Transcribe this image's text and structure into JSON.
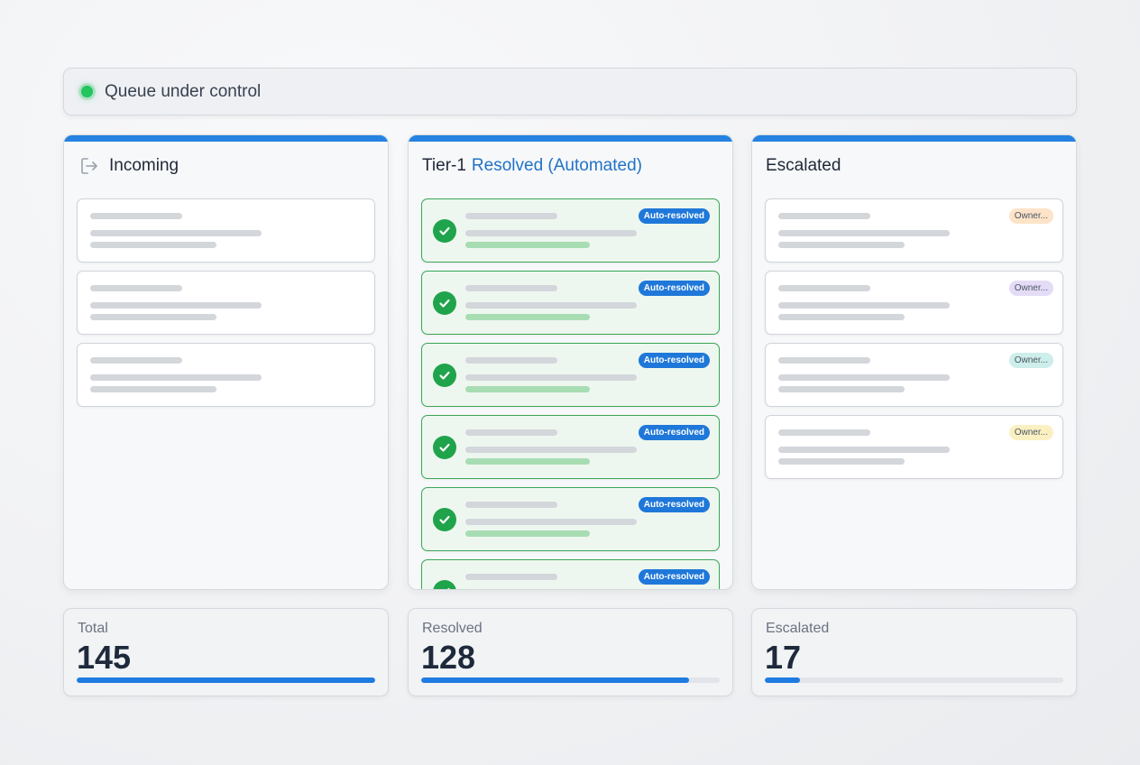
{
  "status": {
    "text": "Queue under control",
    "color": "#22c55e"
  },
  "columns": {
    "incoming": {
      "title": "Incoming",
      "icon": "sign-out-arrow-icon",
      "card_count": 3
    },
    "resolved": {
      "title_prefix": "Tier-1",
      "title_accent": "Resolved (Automated)",
      "badge_label": "Auto-resolved",
      "card_count": 6
    },
    "escalated": {
      "title": "Escalated",
      "cards": [
        {
          "badge": "Owner...",
          "badge_color": "#fde3c8"
        },
        {
          "badge": "Owner...",
          "badge_color": "#e4dcf7"
        },
        {
          "badge": "Owner...",
          "badge_color": "#cdeeea"
        },
        {
          "badge": "Owner...",
          "badge_color": "#fbf0c2"
        }
      ]
    }
  },
  "stats": {
    "total": {
      "label": "Total",
      "value": "145",
      "fill": 1.0
    },
    "resolved": {
      "label": "Resolved",
      "value": "128",
      "fill": 0.898
    },
    "escalated": {
      "label": "Escalated",
      "value": "17",
      "fill": 0.119
    }
  },
  "colors": {
    "accent": "#2582e0",
    "success": "#1fa44c",
    "badge_blue": "#1f78d9"
  }
}
